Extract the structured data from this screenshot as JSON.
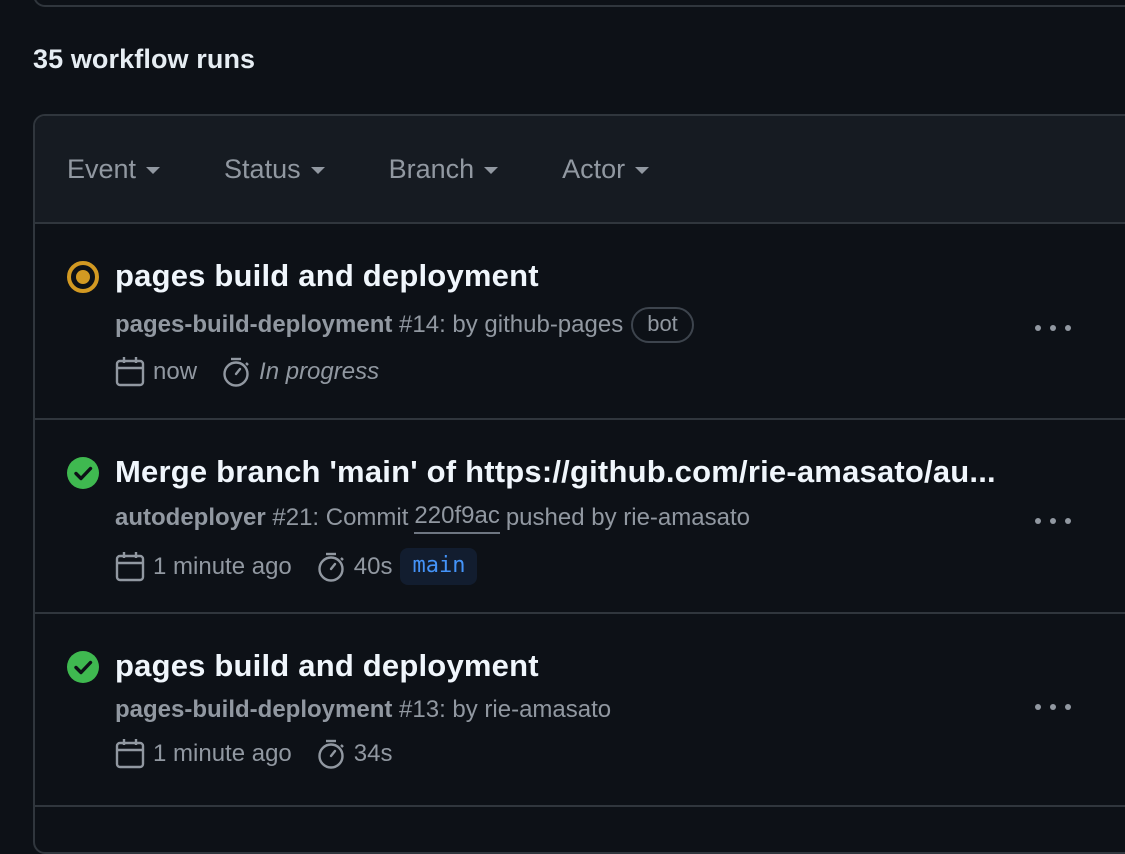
{
  "header": {
    "run_count": "35 workflow runs"
  },
  "filters": [
    {
      "label": "Event"
    },
    {
      "label": "Status"
    },
    {
      "label": "Branch"
    },
    {
      "label": "Actor"
    }
  ],
  "runs": [
    {
      "status": "in_progress",
      "title": "pages build and deployment",
      "workflow": "pages-build-deployment",
      "number_text": " #14: by github-pages",
      "badge": "bot",
      "time": "now",
      "duration": "In progress"
    },
    {
      "status": "success",
      "title": "Merge branch 'main' of https://github.com/rie-amasato/au...",
      "workflow": "autodeployer",
      "number_text": " #21: Commit",
      "commit": "220f9ac",
      "pushed_text": "pushed by rie-amasato",
      "time": "1 minute ago",
      "duration": "40s",
      "branch": "main"
    },
    {
      "status": "success",
      "title": "pages build and deployment",
      "workflow": "pages-build-deployment",
      "number_text": " #13: by rie-amasato",
      "time": "1 minute ago",
      "duration": "34s"
    }
  ],
  "colors": {
    "background": "#0d1117",
    "in_progress": "#d29922",
    "success": "#3fb950",
    "branch_text": "#4493f8"
  }
}
